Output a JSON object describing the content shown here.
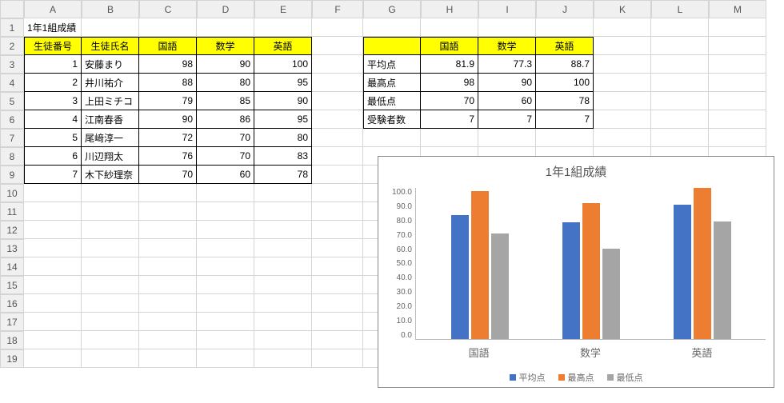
{
  "columns": [
    "A",
    "B",
    "C",
    "D",
    "E",
    "F",
    "G",
    "H",
    "I",
    "J",
    "K",
    "L",
    "M"
  ],
  "rowCount": 19,
  "title": "1年1組成績",
  "students": {
    "headers": [
      "生徒番号",
      "生徒氏名",
      "国語",
      "数学",
      "英語"
    ],
    "rows": [
      {
        "id": 1,
        "name": "安藤まり",
        "k": 98,
        "m": 90,
        "e": 100
      },
      {
        "id": 2,
        "name": "井川祐介",
        "k": 88,
        "m": 80,
        "e": 95
      },
      {
        "id": 3,
        "name": "上田ミチコ",
        "k": 79,
        "m": 85,
        "e": 90
      },
      {
        "id": 4,
        "name": "江南春香",
        "k": 90,
        "m": 86,
        "e": 95
      },
      {
        "id": 5,
        "name": "尾﨑淳一",
        "k": 72,
        "m": 70,
        "e": 80
      },
      {
        "id": 6,
        "name": "川辺翔太",
        "k": 76,
        "m": 70,
        "e": 83
      },
      {
        "id": 7,
        "name": "木下紗理奈",
        "k": 70,
        "m": 60,
        "e": 78
      }
    ]
  },
  "stats": {
    "headers": [
      "",
      "国語",
      "数学",
      "英語"
    ],
    "rowLabels": [
      "平均点",
      "最高点",
      "最低点",
      "受験者数"
    ],
    "rows": [
      {
        "label": "平均点",
        "k": 81.9,
        "m": 77.3,
        "e": 88.7
      },
      {
        "label": "最高点",
        "k": 98,
        "m": 90,
        "e": 100
      },
      {
        "label": "最低点",
        "k": 70,
        "m": 60,
        "e": 78
      },
      {
        "label": "受験者数",
        "k": 7,
        "m": 7,
        "e": 7
      }
    ]
  },
  "chart_data": {
    "type": "bar",
    "title": "1年1組成績",
    "categories": [
      "国語",
      "数学",
      "英語"
    ],
    "series": [
      {
        "name": "平均点",
        "values": [
          81.9,
          77.3,
          88.7
        ],
        "color": "#4472C4"
      },
      {
        "name": "最高点",
        "values": [
          98,
          90,
          100
        ],
        "color": "#ED7D31"
      },
      {
        "name": "最低点",
        "values": [
          70,
          60,
          78
        ],
        "color": "#A5A5A5"
      }
    ],
    "ylim": [
      0,
      100
    ],
    "yticks": [
      0,
      10,
      20,
      30,
      40,
      50,
      60,
      70,
      80,
      90,
      100
    ],
    "xlabel": "",
    "ylabel": ""
  }
}
